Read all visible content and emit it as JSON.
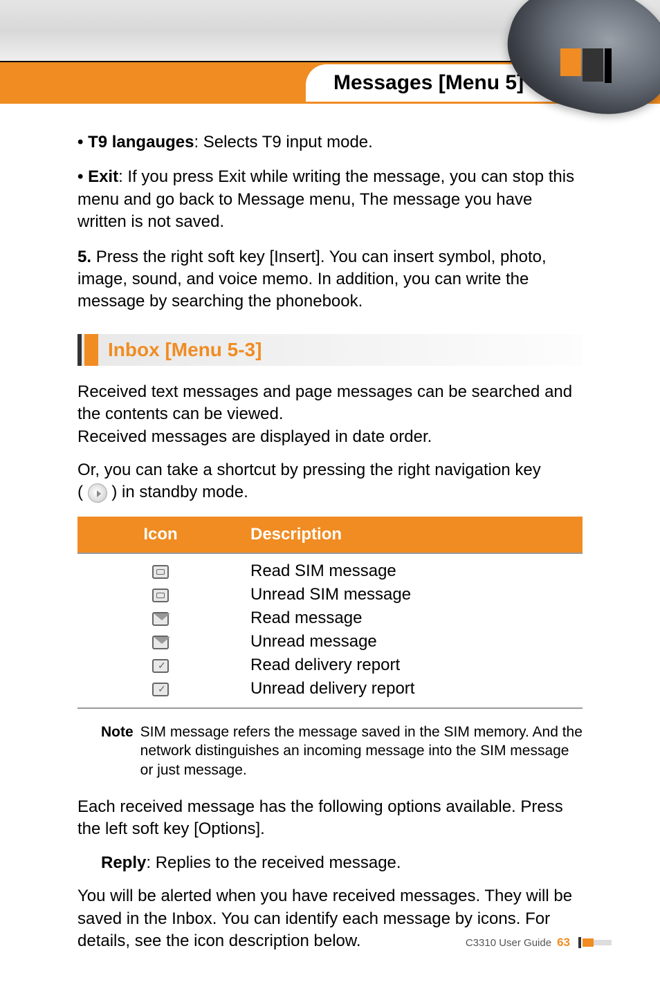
{
  "header": {
    "title": "Messages [Menu 5]"
  },
  "bullets": {
    "t9_label": "T9 langauges",
    "t9_text": ": Selects T9 input mode.",
    "exit_label": "Exit",
    "exit_text": ":  If you press Exit while writing the message, you can stop this menu and go back to Message menu, The message you have written is not saved."
  },
  "step5": {
    "num": "5.",
    "text": "Press the right soft key [Insert]. You can insert symbol, photo, image, sound, and voice memo. In addition, you can write the message by searching the phonebook."
  },
  "section": {
    "title": "Inbox [Menu 5-3]"
  },
  "body": {
    "p1": "Received text messages and page messages can be searched and the contents can be viewed.",
    "p2": "Received messages are displayed in date order.",
    "p3a": "Or, you can take a shortcut by pressing the right navigation key",
    "p3b": "(",
    "p3c": ") in standby mode."
  },
  "table": {
    "head_icon": "Icon",
    "head_desc": "Description",
    "rows": [
      {
        "desc": "Read SIM message"
      },
      {
        "desc": "Unread SIM message"
      },
      {
        "desc": "Read message"
      },
      {
        "desc": "Unread message"
      },
      {
        "desc": "Read delivery report"
      },
      {
        "desc": "Unread delivery report"
      }
    ]
  },
  "note": {
    "label": "Note",
    "text": "SIM message refers the message saved in the SIM memory. And the network distinguishes an incoming message into the SIM message or just message."
  },
  "options": {
    "intro": "Each received message has the following options available. Press the left soft key [Options].",
    "reply_label": "Reply",
    "reply_text": ": Replies to the received message.",
    "alert": "You will be alerted when you have received messages. They will be saved in the Inbox. You can identify each message by icons. For details, see the icon description below."
  },
  "footer": {
    "guide": "C3310 User Guide",
    "page": "63"
  }
}
